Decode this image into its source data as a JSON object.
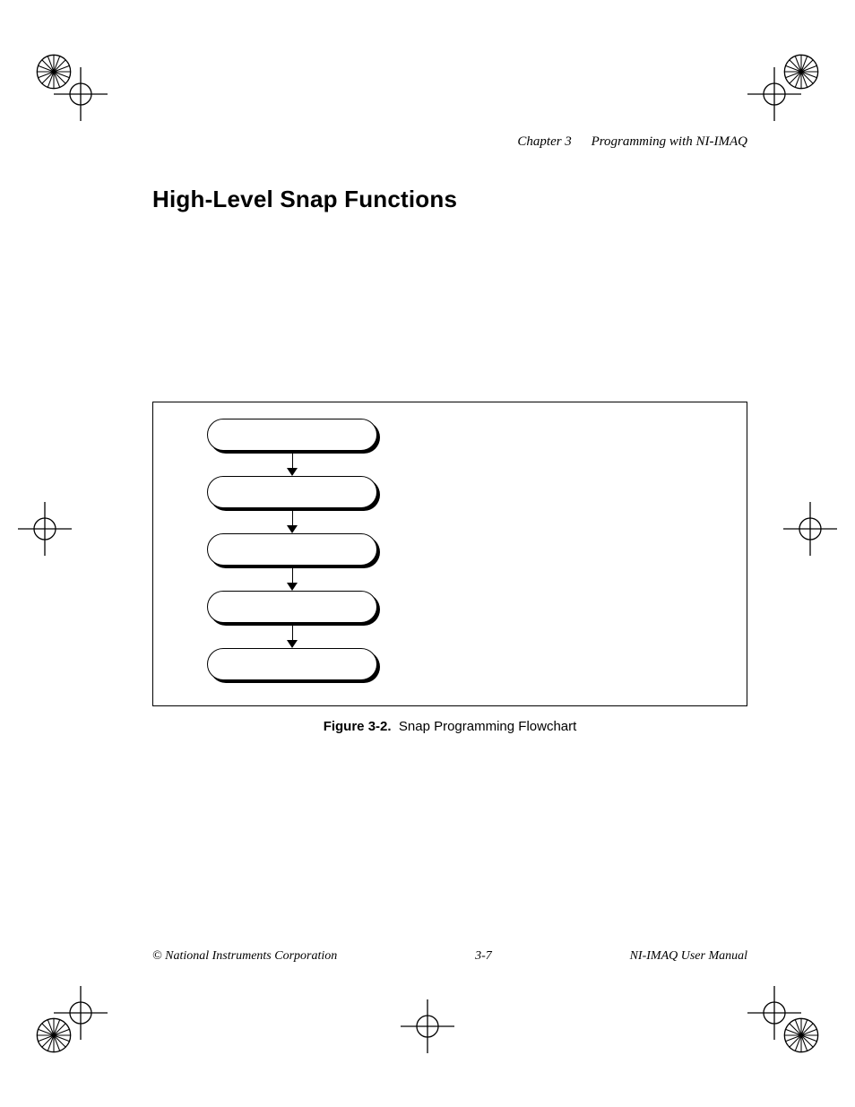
{
  "runningHead": {
    "chapter": "Chapter 3",
    "title": "Programming with NI-IMAQ"
  },
  "sectionTitle": "High-Level Snap Functions",
  "figure": {
    "caption_label": "Figure 3-2.",
    "caption_text": "Snap Programming Flowchart",
    "nodes": [
      "",
      "",
      "",
      "",
      ""
    ]
  },
  "footer": {
    "left": "© National Instruments Corporation",
    "center": "3-7",
    "right": "NI-IMAQ User Manual"
  }
}
